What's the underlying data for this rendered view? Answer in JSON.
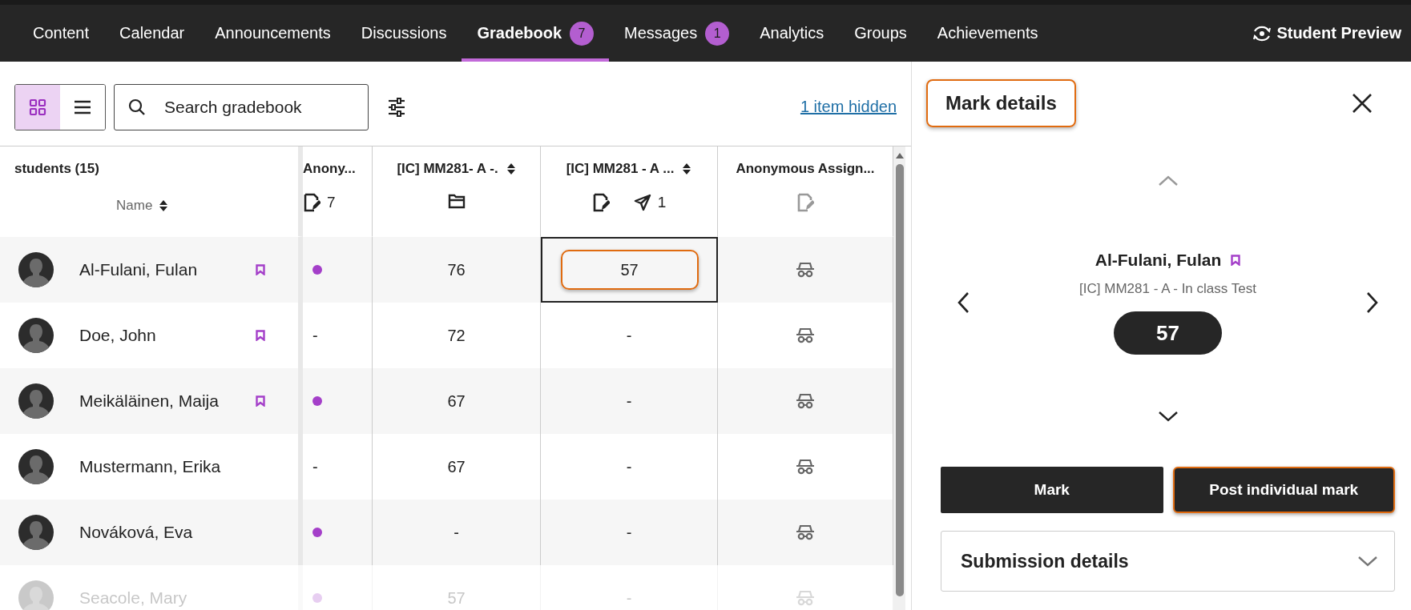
{
  "nav": {
    "items": [
      {
        "label": "Content",
        "selected": false
      },
      {
        "label": "Calendar",
        "selected": false
      },
      {
        "label": "Announcements",
        "selected": false
      },
      {
        "label": "Discussions",
        "selected": false
      },
      {
        "label": "Gradebook",
        "selected": true,
        "badge": "7"
      },
      {
        "label": "Messages",
        "selected": false,
        "badge": "1"
      },
      {
        "label": "Analytics",
        "selected": false
      },
      {
        "label": "Groups",
        "selected": false
      },
      {
        "label": "Achievements",
        "selected": false
      }
    ],
    "student_preview": "Student Preview"
  },
  "toolbar": {
    "view_modes": [
      {
        "kind": "grid",
        "selected": true
      },
      {
        "kind": "list",
        "selected": false
      }
    ],
    "search": {
      "placeholder": "Search gradebook"
    },
    "hidden_link": "1 item hidden"
  },
  "table": {
    "student_header": "students (15)",
    "name_sort": "Name",
    "columns": [
      {
        "title": "Anony...",
        "sortable": false,
        "icons": [
          {
            "kind": "document",
            "count": "7",
            "muted": false
          }
        ]
      },
      {
        "title": "[IC] MM281- A -.",
        "sortable": true,
        "icons": [
          {
            "kind": "folder",
            "muted": false
          }
        ]
      },
      {
        "title": "[IC] MM281 - A ...",
        "sortable": true,
        "icons": [
          {
            "kind": "document",
            "muted": false
          },
          {
            "kind": "send",
            "count": "1",
            "muted": false
          }
        ]
      },
      {
        "title": "Anonymous Assign...",
        "sortable": false,
        "icons": [
          {
            "kind": "document",
            "muted": true
          }
        ]
      }
    ],
    "rows": [
      {
        "name": "Al-Fulani, Fulan",
        "flagged": true,
        "faded": false,
        "cells": [
          {
            "kind": "dot"
          },
          {
            "kind": "text",
            "text": "76"
          },
          {
            "kind": "text",
            "text": "57",
            "selected": true,
            "highlighted": true
          },
          {
            "kind": "anonymous"
          }
        ]
      },
      {
        "name": "Doe, John",
        "flagged": true,
        "faded": false,
        "cells": [
          {
            "kind": "text",
            "text": "-"
          },
          {
            "kind": "text",
            "text": "72"
          },
          {
            "kind": "text",
            "text": "-",
            "selected": false,
            "highlighted": false
          },
          {
            "kind": "anonymous"
          }
        ]
      },
      {
        "name": "Meikäläinen, Maija",
        "flagged": true,
        "faded": false,
        "cells": [
          {
            "kind": "dot"
          },
          {
            "kind": "text",
            "text": "67"
          },
          {
            "kind": "text",
            "text": "-",
            "selected": false,
            "highlighted": false
          },
          {
            "kind": "anonymous"
          }
        ]
      },
      {
        "name": "Mustermann, Erika",
        "flagged": false,
        "faded": false,
        "cells": [
          {
            "kind": "text",
            "text": "-"
          },
          {
            "kind": "text",
            "text": "67"
          },
          {
            "kind": "text",
            "text": "-",
            "selected": false,
            "highlighted": false
          },
          {
            "kind": "anonymous"
          }
        ]
      },
      {
        "name": "Nováková, Eva",
        "flagged": false,
        "faded": false,
        "cells": [
          {
            "kind": "dot"
          },
          {
            "kind": "text",
            "text": "-"
          },
          {
            "kind": "text",
            "text": "-",
            "selected": false,
            "highlighted": false
          },
          {
            "kind": "anonymous"
          }
        ]
      },
      {
        "name": "Seacole, Mary",
        "flagged": false,
        "faded": true,
        "cells": [
          {
            "kind": "dot"
          },
          {
            "kind": "text",
            "text": "57"
          },
          {
            "kind": "text",
            "text": "-",
            "selected": false,
            "highlighted": false
          },
          {
            "kind": "anonymous"
          }
        ]
      }
    ]
  },
  "panel": {
    "title": "Mark details",
    "title_highlighted": true,
    "student": "Al-Fulani, Fulan",
    "flagged": true,
    "assessment": "[IC] MM281 - A - In class Test",
    "mark": "57",
    "buttons": [
      {
        "label": "Mark",
        "highlighted": false
      },
      {
        "label": "Post individual mark",
        "highlighted": true
      }
    ],
    "section": "Submission details"
  }
}
